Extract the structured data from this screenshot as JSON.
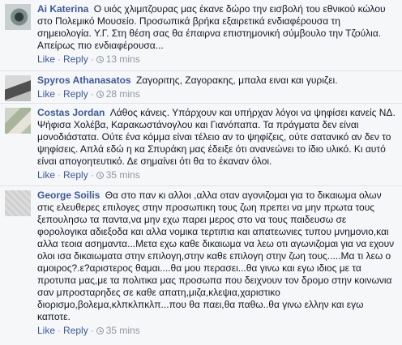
{
  "comments": [
    {
      "author": "Ai Katerina",
      "text": "Ο υιός χλιμιτζουρας μας έκανε δώρο την εισβολή του εθνικού κώλου στο Πολεμικό Μουσείο. Προσωπικά βρήκα εξαιρετικά ενδιαφέρουσα τη σημειολογία. Υ.Γ. Στη θέση σας θα έπαιρνα επιστημονική σύμβουλο την Τζούλια. Απείρως πιο ενδιαφέρουσα...",
      "like": "Like",
      "reply": "Reply",
      "time": "13 mins",
      "avatar_icon": "eye-avatar"
    },
    {
      "author": "Spyros Athanasatos",
      "text": "Ζαγοριτης, Ζαγορακης, μπαλα ειναι και γυριζει.",
      "like": "Like",
      "reply": "Reply",
      "time": "28 mins",
      "avatar_icon": "man-avatar"
    },
    {
      "author": "Costas Jordan",
      "text": "Λάθος κάνεις. Υπάρχουν και υπήρχαν λόγοι να ψηφίσει κανείς ΝΔ. Ψήφισα Χολέβα, Καρακωστάνογλου και Γιανόπαπα. Τα πράγματα δεν είναι μονοδιάστατα. Ούτε ένα κόμμα είναι τέλειο αν το ψηφίζεις, ούτε σατανικό αν δεν το ψηφίσεις. Απλά εδώ η κα Σπυράκη μας έδειξε ότι ανανεώνει το ίδιο υλικό. Κι αυτό είναι απογοητευτικό. Δε σημαίνει ότι θα το έκαναν όλοι.",
      "like": "Like",
      "reply": "Reply",
      "time": "35 mins",
      "avatar_icon": "map-avatar"
    },
    {
      "author": "George Soilis",
      "text": "Θα στο παν κι αλλοι ,αλλα οταν αγονιζομαι για το δικαιωμα ολων στις ελευθερες επιλογες στην προσωπικη τους ζωη πρεπει να μην πρωτα τους ξεπουλησω τα παντα,να μην εχω παρει μερος στο να τους παιδευσω σε φορολογικα αδιεξοδα και αλλα νομικα τερτιπια και απατεωνιες τυπου μνημονιο,και αλλα τεοια ασημαντα...Μετα εχω καθε δικαιωμα να λεω οτι αγωνιζομαι για να εχουν ολοι ισα δικαιωματα στην επιλογη,στην καθε επιλογη στην ζωη τους.....Μα τι λεω ο αμοιρος?.ε?αριστερος θαμαι....θα μου περασει...θα γινω και εγω ιδιος με τα προτυπα μας,με τα πολιτικα μας προσωπα που δειχνουν τον δρομο στην κοινωνια σαν μπροσταρηδες σε καθε απατη,μιζα,κλεψια,χαριστικο διορισμο,βολεμα,κλπκλπκλπ...που θα παει,θα παθω..θα γινω ελλην και εγω καποτε.",
      "like": "Like",
      "reply": "Reply",
      "time": "35 mins",
      "avatar_icon": "cross-avatar"
    }
  ]
}
